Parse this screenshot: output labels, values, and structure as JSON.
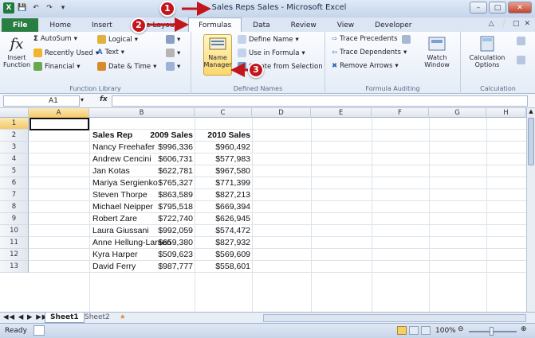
{
  "window": {
    "title": "Sales Reps Sales - Microsoft Excel"
  },
  "tabs": [
    "File",
    "Home",
    "Insert",
    "Page Layout",
    "Formulas",
    "Data",
    "Review",
    "View",
    "Developer"
  ],
  "active_tab": "Formulas",
  "ribbon": {
    "function_library": {
      "label": "Function Library",
      "insert_function": [
        "Insert",
        "Function"
      ],
      "autosum": "AutoSum",
      "recently_used": "Recently Used",
      "financial": "Financial",
      "logical": "Logical",
      "text": "Text",
      "date_time": "Date & Time"
    },
    "defined_names": {
      "label": "Defined Names",
      "name_manager": [
        "Name",
        "Manager"
      ],
      "define_name": "Define Name",
      "use_in_formula": "Use in Formula",
      "create_from_selection": "Create from Selection"
    },
    "formula_auditing": {
      "label": "Formula Auditing",
      "trace_precedents": "Trace Precedents",
      "trace_dependents": "Trace Dependents",
      "remove_arrows": "Remove Arrows",
      "watch_window": [
        "Watch",
        "Window"
      ]
    },
    "calculation": {
      "label": "Calculation",
      "options": [
        "Calculation",
        "Options"
      ]
    }
  },
  "formula_bar": {
    "name_box": "A1",
    "fx": "fx",
    "value": ""
  },
  "columns": [
    "A",
    "B",
    "C",
    "D",
    "E",
    "F",
    "G",
    "H"
  ],
  "rows": [
    "1",
    "2",
    "3",
    "4",
    "5",
    "6",
    "7",
    "8",
    "9",
    "10",
    "11",
    "12",
    "13"
  ],
  "table": {
    "headers": [
      "Sales Rep",
      "2009 Sales",
      "2010 Sales"
    ],
    "data": [
      [
        "Nancy Freehafer",
        "$996,336",
        "$960,492"
      ],
      [
        "Andrew Cencini",
        "$606,731",
        "$577,983"
      ],
      [
        "Jan Kotas",
        "$622,781",
        "$967,580"
      ],
      [
        "Mariya Sergienko",
        "$765,327",
        "$771,399"
      ],
      [
        "Steven Thorpe",
        "$863,589",
        "$827,213"
      ],
      [
        "Michael Neipper",
        "$795,518",
        "$669,394"
      ],
      [
        "Robert Zare",
        "$722,740",
        "$626,945"
      ],
      [
        "Laura Giussani",
        "$992,059",
        "$574,472"
      ],
      [
        "Anne Hellung-Larsen",
        "$659,380",
        "$827,932"
      ],
      [
        "Kyra Harper",
        "$509,623",
        "$569,609"
      ],
      [
        "David Ferry",
        "$987,777",
        "$558,601"
      ]
    ]
  },
  "sheets": [
    "Sheet1",
    "Sheet2"
  ],
  "status": {
    "ready": "Ready",
    "zoom": "100%"
  },
  "callouts": [
    "1",
    "2",
    "3"
  ],
  "colors": {
    "accent": "#c3161c",
    "file_tab": "#2a7d43"
  }
}
